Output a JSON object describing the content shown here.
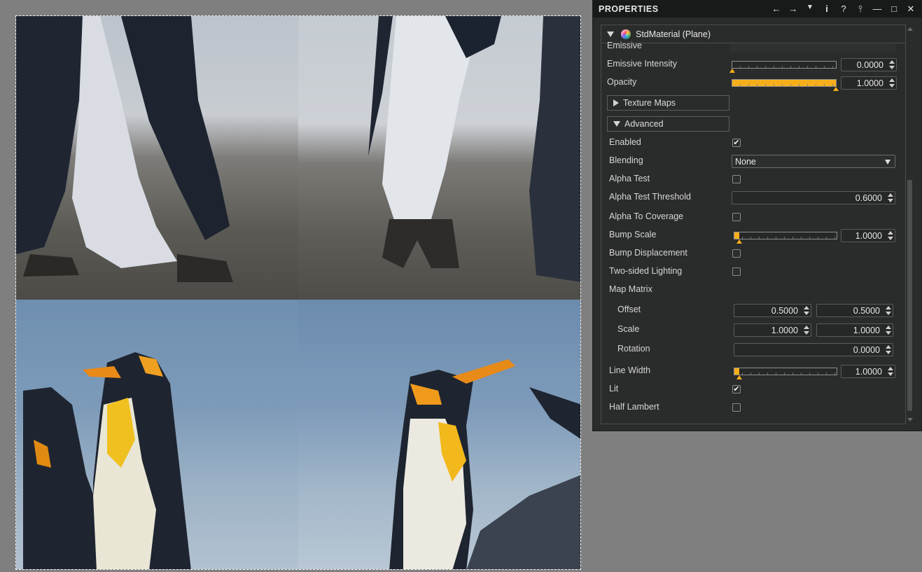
{
  "panel": {
    "title": "PROPERTIES",
    "header_icons": [
      "back-arrow-icon",
      "forward-arrow-icon",
      "dropdown-icon",
      "info-icon",
      "help-icon",
      "pin-icon",
      "minimize-icon",
      "maximize-icon",
      "close-icon"
    ],
    "header_glyphs": {
      "back": "←",
      "forward": "→",
      "dropdown": "▼",
      "info": "i",
      "help": "?",
      "pin": "⫯",
      "minimize": "—",
      "maximize": "□",
      "close": "✕"
    }
  },
  "component": {
    "title": "StdMaterial (Plane)"
  },
  "props": {
    "emissive_label": "Emissive",
    "emissive_intensity": {
      "label": "Emissive Intensity",
      "value": "0.0000",
      "level": 0.0
    },
    "opacity": {
      "label": "Opacity",
      "value": "1.0000",
      "level": 1.0
    },
    "texture_maps": "Texture Maps",
    "advanced": "Advanced",
    "enabled": {
      "label": "Enabled",
      "checked": true
    },
    "blending": {
      "label": "Blending",
      "value": "None"
    },
    "alpha_test": {
      "label": "Alpha Test",
      "checked": false
    },
    "alpha_test_threshold": {
      "label": "Alpha Test Threshold",
      "value": "0.6000"
    },
    "alpha_to_coverage": {
      "label": "Alpha To Coverage",
      "checked": false
    },
    "bump_scale": {
      "label": "Bump Scale",
      "value": "1.0000",
      "level": 0.05
    },
    "bump_displacement": {
      "label": "Bump Displacement",
      "checked": false
    },
    "two_sided_lighting": {
      "label": "Two-sided Lighting",
      "checked": false
    },
    "map_matrix": {
      "label": "Map Matrix",
      "offset": {
        "label": "Offset",
        "x": "0.5000",
        "y": "0.5000"
      },
      "scale": {
        "label": "Scale",
        "x": "1.0000",
        "y": "1.0000"
      },
      "rotation": {
        "label": "Rotation",
        "value": "0.0000"
      }
    },
    "line_width": {
      "label": "Line Width",
      "value": "1.0000",
      "level": 0.05
    },
    "lit": {
      "label": "Lit",
      "checked": true
    },
    "half_lambert": {
      "label": "Half Lambert",
      "checked": false
    }
  },
  "colors": {
    "accent": "#f6ae1a",
    "panel_bg": "#2a2b2b",
    "header_bg": "#181919",
    "viewport_bg": "#7f7f7f"
  }
}
